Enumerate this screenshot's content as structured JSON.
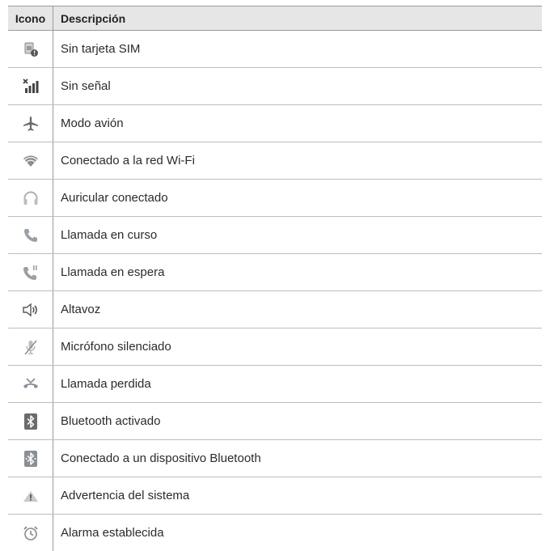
{
  "header": {
    "icon_col": "Icono",
    "desc_col": "Descripción"
  },
  "rows": [
    {
      "icon": "no-sim-icon",
      "label": "Sin tarjeta SIM"
    },
    {
      "icon": "no-signal-icon",
      "label": "Sin señal"
    },
    {
      "icon": "airplane-icon",
      "label": "Modo avión"
    },
    {
      "icon": "wifi-icon",
      "label": "Conectado a la red Wi-Fi"
    },
    {
      "icon": "headset-icon",
      "label": "Auricular conectado"
    },
    {
      "icon": "call-icon",
      "label": "Llamada en curso"
    },
    {
      "icon": "call-hold-icon",
      "label": "Llamada en espera"
    },
    {
      "icon": "speaker-icon",
      "label": "Altavoz"
    },
    {
      "icon": "mic-muted-icon",
      "label": "Micrófono silenciado"
    },
    {
      "icon": "missed-call-icon",
      "label": "Llamada perdida"
    },
    {
      "icon": "bluetooth-icon",
      "label": "Bluetooth activado"
    },
    {
      "icon": "bluetooth-connected-icon",
      "label": "Conectado a un dispositivo Bluetooth"
    },
    {
      "icon": "warning-icon",
      "label": "Advertencia del sistema"
    },
    {
      "icon": "alarm-icon",
      "label": "Alarma establecida"
    }
  ]
}
